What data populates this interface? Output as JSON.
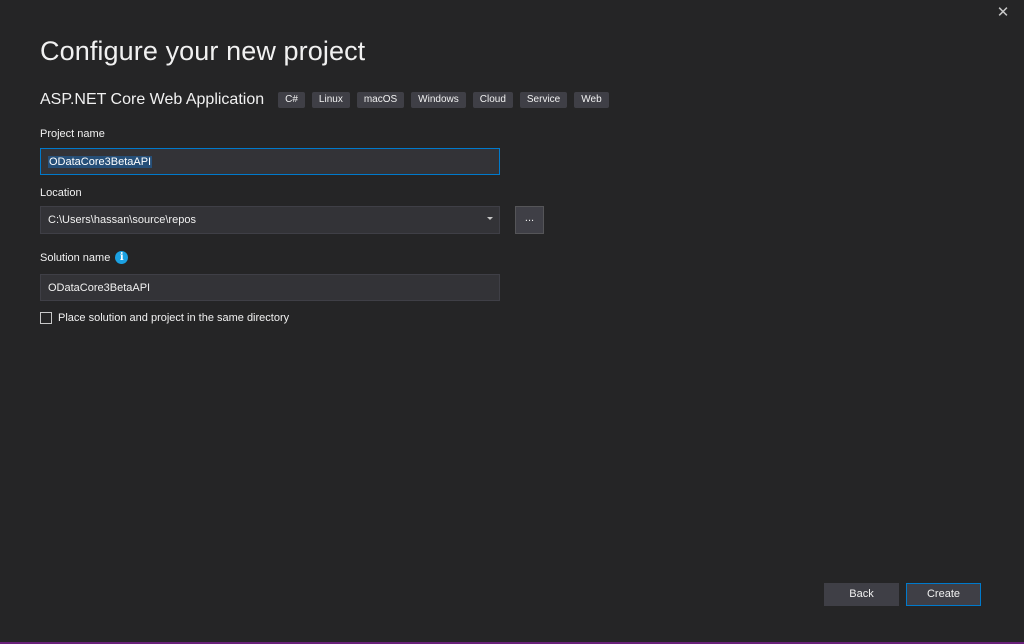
{
  "window": {
    "close_glyph": "✕"
  },
  "title": "Configure your new project",
  "template": {
    "name": "ASP.NET Core Web Application",
    "tags": [
      "C#",
      "Linux",
      "macOS",
      "Windows",
      "Cloud",
      "Service",
      "Web"
    ]
  },
  "project_name": {
    "label": "Project name",
    "value": "ODataCore3BetaAPI"
  },
  "location": {
    "label": "Location",
    "value": "C:\\Users\\hassan\\source\\repos",
    "browse_label": "..."
  },
  "solution_name": {
    "label": "Solution name",
    "info_glyph": "i",
    "value": "ODataCore3BetaAPI"
  },
  "same_directory": {
    "label": "Place solution and project in the same directory",
    "checked": false
  },
  "buttons": {
    "back": "Back",
    "create": "Create"
  },
  "colors": {
    "background": "#252526",
    "accent": "#007acc",
    "info": "#1ba1e2",
    "frame_border": "#68217a"
  }
}
